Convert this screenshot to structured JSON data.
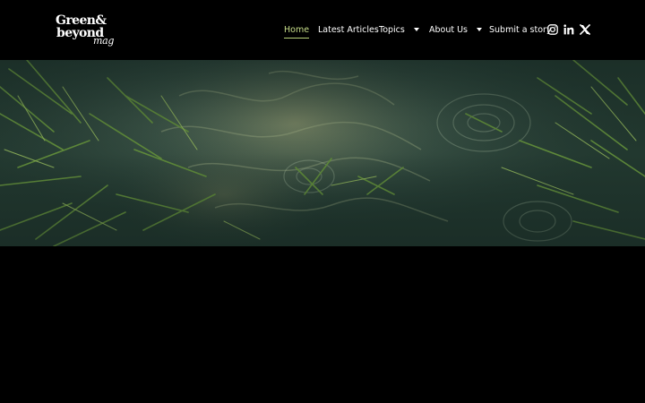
{
  "brand": {
    "logo_line1": "Green&",
    "logo_line2": "beyond",
    "logo_script": "mag"
  },
  "nav": {
    "items": [
      {
        "label": "Home",
        "active": true
      },
      {
        "label": "Latest Articles"
      },
      {
        "label": "Topics",
        "has_dropdown": true
      },
      {
        "label": "About Us",
        "has_dropdown": true
      },
      {
        "label": "Submit a story"
      }
    ]
  },
  "social": [
    {
      "icon": "instagram-icon"
    },
    {
      "icon": "linkedin-icon"
    },
    {
      "icon": "x-icon"
    }
  ],
  "hero": {
    "image": "water-surface-with-ripples-and-green-plants"
  },
  "colors": {
    "background": "#000000",
    "text": "#ffffff",
    "accent": "#b9d37a",
    "hero_water": "#223a35"
  }
}
